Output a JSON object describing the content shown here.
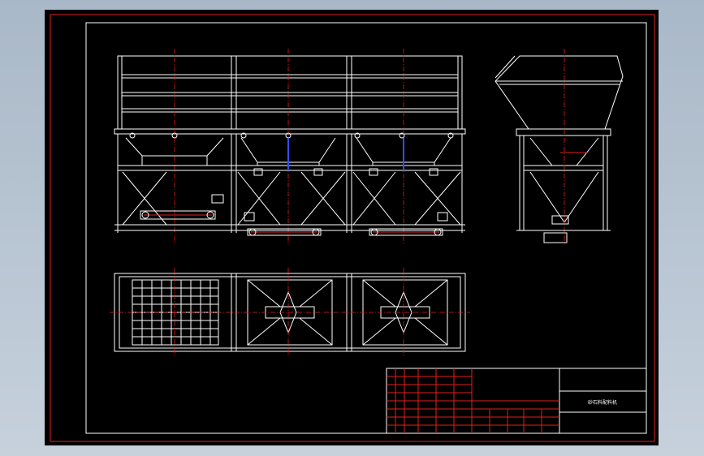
{
  "title_block": {
    "drawing_name": "砂石料配料机"
  }
}
